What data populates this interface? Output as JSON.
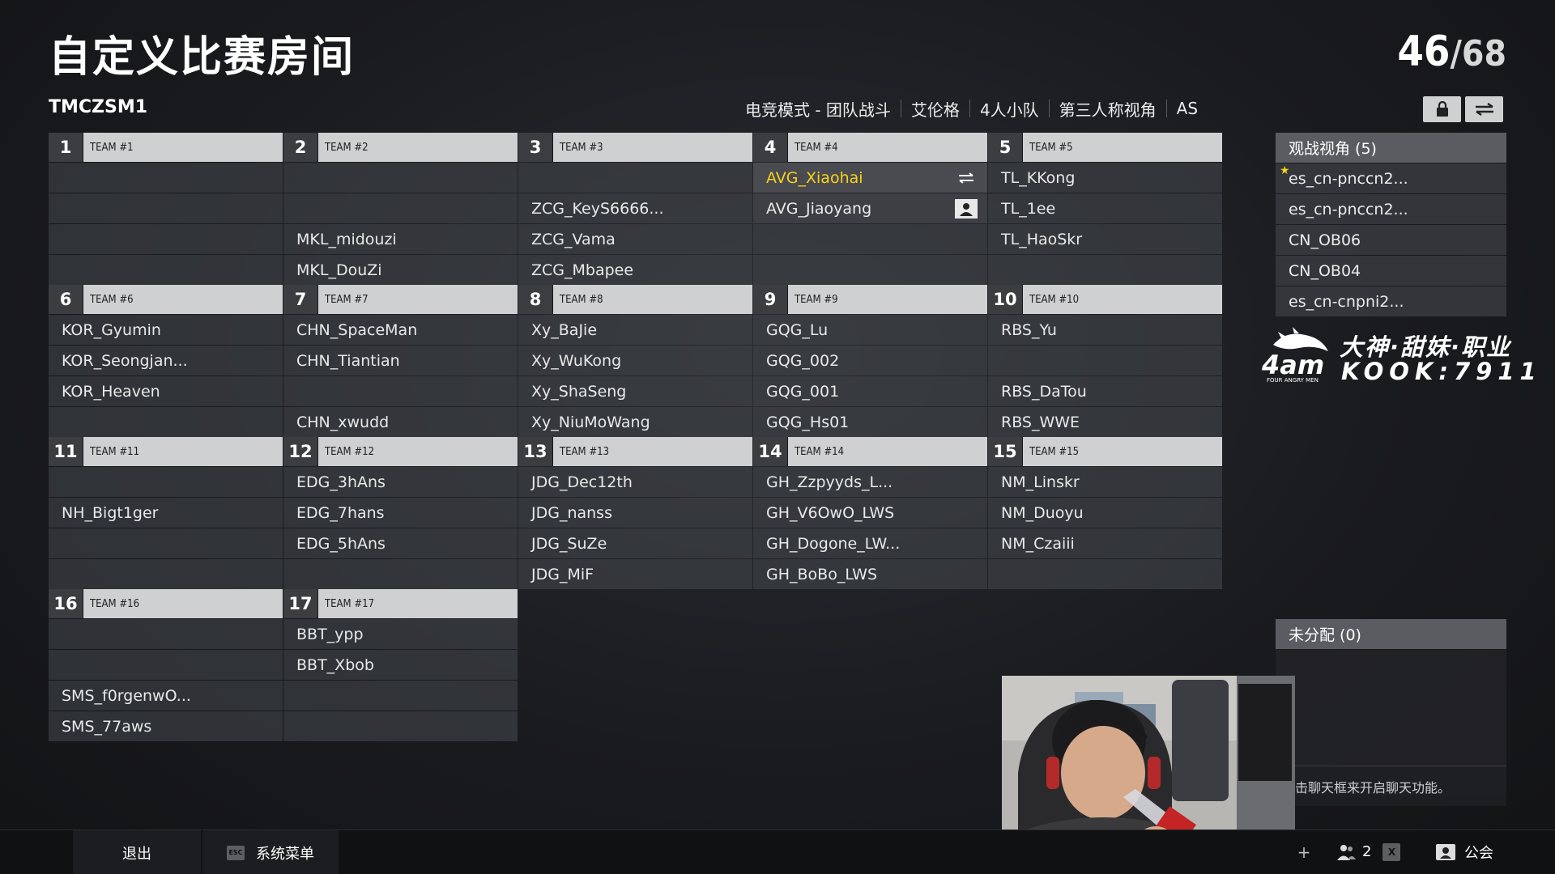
{
  "title": "自定义比赛房间",
  "player_count": {
    "current": "46",
    "separator": "/",
    "total": "68"
  },
  "room_code": "TMCZSM1",
  "settings": [
    "电竞模式 - 团队战斗",
    "艾伦格",
    "4人小队",
    "第三人称视角",
    "AS"
  ],
  "teams": [
    {
      "num": "1",
      "name": "TEAM #1",
      "slots": [
        "",
        "",
        "",
        ""
      ]
    },
    {
      "num": "2",
      "name": "TEAM #2",
      "slots": [
        "",
        "",
        "MKL_midouzi",
        "MKL_DouZi"
      ]
    },
    {
      "num": "3",
      "name": "TEAM #3",
      "slots": [
        "",
        "ZCG_KeyS6666...",
        "ZCG_Vama",
        "ZCG_Mbapee"
      ]
    },
    {
      "num": "4",
      "name": "TEAM #4",
      "slots": [
        "AVG_Xiaohai",
        "AVG_Jiaoyang",
        "",
        ""
      ]
    },
    {
      "num": "5",
      "name": "TEAM #5",
      "slots": [
        "TL_KKong",
        "TL_1ee",
        "TL_HaoSkr",
        ""
      ]
    },
    {
      "num": "6",
      "name": "TEAM #6",
      "slots": [
        "KOR_Gyumin",
        "KOR_Seongjan...",
        "KOR_Heaven",
        ""
      ]
    },
    {
      "num": "7",
      "name": "TEAM #7",
      "slots": [
        "CHN_SpaceMan",
        "CHN_Tiantian",
        "",
        "CHN_xwudd"
      ]
    },
    {
      "num": "8",
      "name": "TEAM #8",
      "slots": [
        "Xy_BaJie",
        "Xy_WuKong",
        "Xy_ShaSeng",
        "Xy_NiuMoWang"
      ]
    },
    {
      "num": "9",
      "name": "TEAM #9",
      "slots": [
        "GQG_Lu",
        "GQG_002",
        "GQG_001",
        "GQG_Hs01"
      ]
    },
    {
      "num": "10",
      "name": "TEAM #10",
      "slots": [
        "RBS_Yu",
        "",
        "RBS_DaTou",
        "RBS_WWE"
      ]
    },
    {
      "num": "11",
      "name": "TEAM #11",
      "slots": [
        "",
        "NH_Bigt1ger",
        "",
        ""
      ]
    },
    {
      "num": "12",
      "name": "TEAM #12",
      "slots": [
        "EDG_3hAns",
        "EDG_7hans",
        "EDG_5hAns",
        ""
      ]
    },
    {
      "num": "13",
      "name": "TEAM #13",
      "slots": [
        "JDG_Dec12th",
        "JDG_nanss",
        "JDG_SuZe",
        "JDG_MiF"
      ]
    },
    {
      "num": "14",
      "name": "TEAM #14",
      "slots": [
        "GH_Zzpyyds_L...",
        "GH_V6OwO_LWS",
        "GH_Dogone_LW...",
        "GH_BoBo_LWS"
      ]
    },
    {
      "num": "15",
      "name": "TEAM #15",
      "slots": [
        "NM_Linskr",
        "NM_Duoyu",
        "NM_Czaiii",
        ""
      ]
    },
    {
      "num": "16",
      "name": "TEAM #16",
      "slots": [
        "",
        "",
        "SMS_f0rgenwO...",
        "SMS_77aws"
      ]
    },
    {
      "num": "17",
      "name": "TEAM #17",
      "slots": [
        "BBT_ypp",
        "BBT_Xbob",
        "",
        ""
      ]
    }
  ],
  "spectators": {
    "header": "观战视角 (5)",
    "items": [
      "es_cn-pnccn2...",
      "es_cn-pnccn2...",
      "CN_OB06",
      "CN_OB04",
      "es_cn-cnpni2..."
    ]
  },
  "logo": {
    "mark": "4am",
    "subtitle": "FOUR ANGRY MEN",
    "line1": "大神·甜妹·职业",
    "line2": "KOOK:7911"
  },
  "unassigned": {
    "header": "未分配 (0)"
  },
  "chat_hint": "击聊天框来开启聊天功能。",
  "bottom": {
    "exit": "退出",
    "esc_key": "ESC",
    "system_menu": "系统菜单",
    "plus": "+",
    "friends_count": "2",
    "x_key": "X",
    "guild": "公会"
  },
  "colors": {
    "highlight_player": "#f6d21d",
    "header_bg": "#cfd0d2"
  }
}
